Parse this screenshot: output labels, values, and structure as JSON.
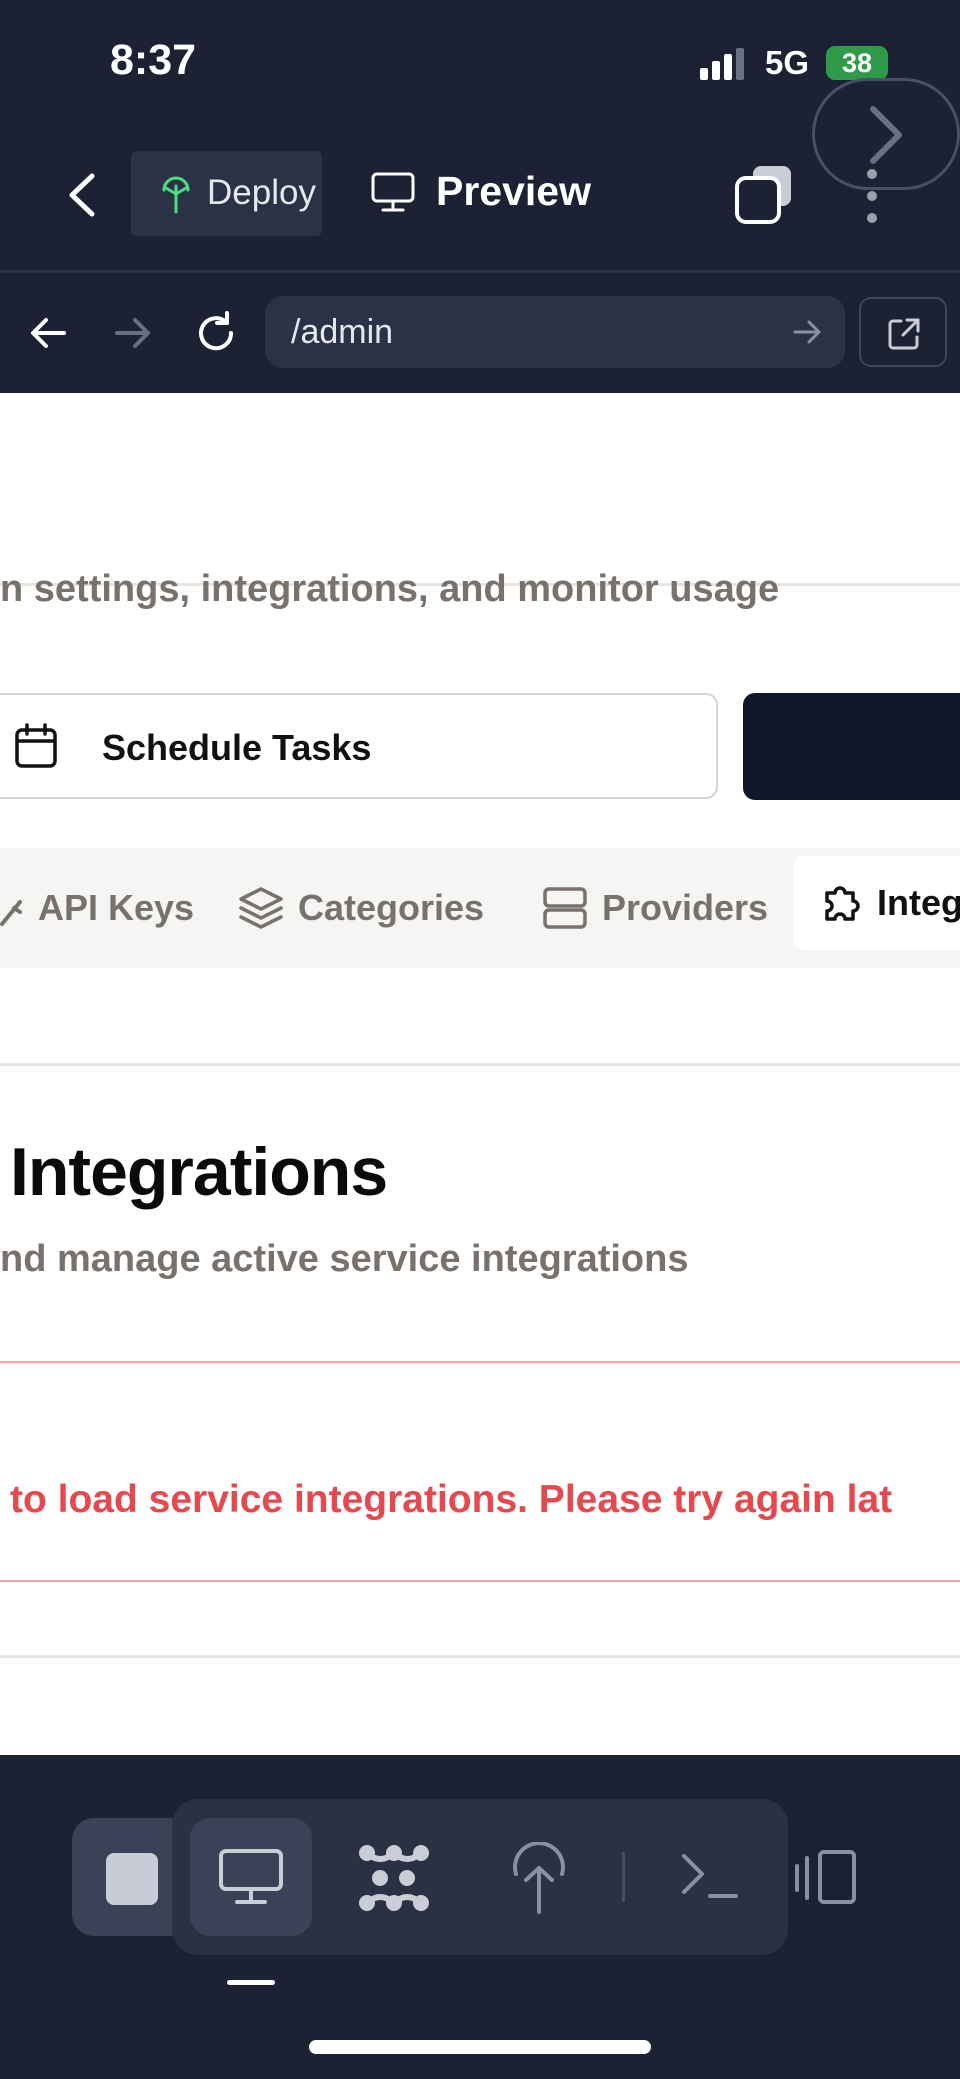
{
  "status_bar": {
    "time": "8:37",
    "network": "5G",
    "battery": "38"
  },
  "header": {
    "deploy_label": "Deploy",
    "preview_label": "Preview"
  },
  "url_bar": {
    "path": "/admin"
  },
  "page": {
    "subtitle": "n settings, integrations, and monitor usage",
    "schedule_button": "Schedule Tasks",
    "tabs": [
      {
        "label": "API Keys",
        "icon": "key-icon"
      },
      {
        "label": "Categories",
        "icon": "layers-icon"
      },
      {
        "label": "Providers",
        "icon": "server-icon"
      },
      {
        "label": "Integ",
        "icon": "puzzle-icon",
        "active": true
      }
    ],
    "section_title": "Integrations",
    "section_subtitle": "nd manage active service integrations",
    "error_message": "to load service integrations. Please try again lat"
  },
  "colors": {
    "accent_green": "#2f9a4a",
    "error_red": "#e5484d",
    "dark_bg": "#1c2233"
  }
}
